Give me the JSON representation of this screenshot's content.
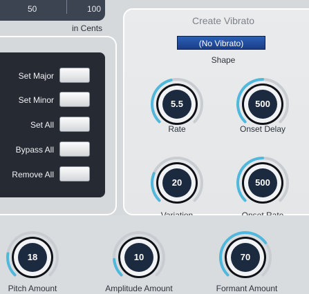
{
  "ruler": {
    "ticks": [
      "50",
      "100"
    ],
    "unit_label": "in Cents"
  },
  "pitch_buttons": [
    {
      "label": "Set Major"
    },
    {
      "label": "Set Minor"
    },
    {
      "label": "Set All"
    },
    {
      "label": "Bypass All"
    },
    {
      "label": "Remove All"
    }
  ],
  "vibrato": {
    "title": "Create Vibrato",
    "shape_value": "(No Vibrato)",
    "shape_label": "Shape",
    "knobs": [
      {
        "label": "Rate",
        "value": "5.5",
        "fill": 0.45
      },
      {
        "label": "Onset Delay",
        "value": "500",
        "fill": 0.5
      },
      {
        "label": "Variation",
        "value": "20",
        "fill": 0.25
      },
      {
        "label": "Onset Rate",
        "value": "500",
        "fill": 0.5
      }
    ]
  },
  "bottom_knobs": [
    {
      "label": "Pitch Amount",
      "value": "18",
      "fill": 0.2
    },
    {
      "label": "Amplitude Amount",
      "value": "10",
      "fill": 0.15
    },
    {
      "label": "Formant Amount",
      "value": "70",
      "fill": 0.7
    }
  ],
  "colors": {
    "knob_arc": "#4fb8dc",
    "knob_face": "#1b2a3f",
    "panel_dark": "#262b33",
    "shape_fill": "#2b5fb8"
  }
}
